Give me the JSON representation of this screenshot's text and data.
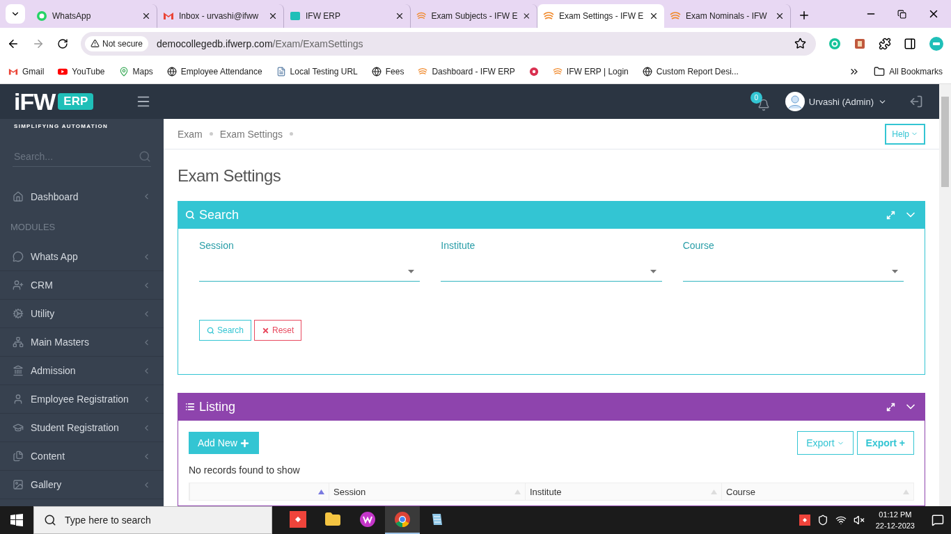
{
  "browser": {
    "tabs": [
      {
        "title": "WhatsApp",
        "kind": "whatsapp",
        "selected": false
      },
      {
        "title": "Inbox - urvashi@ifww",
        "kind": "gmail",
        "selected": false
      },
      {
        "title": "IFW ERP",
        "kind": "ifw",
        "selected": false
      },
      {
        "title": "Exam Subjects - IFW E",
        "kind": "swirl",
        "selected": false
      },
      {
        "title": "Exam Settings - IFW E",
        "kind": "swirl",
        "selected": true
      },
      {
        "title": "Exam Nominals - IFW",
        "kind": "swirl",
        "selected": false
      }
    ],
    "security": "Not secure",
    "url_host": "democollegedb.ifwerp.com",
    "url_path": "/Exam/ExamSettings",
    "bookmarks": [
      {
        "label": "Gmail",
        "kind": "gmail"
      },
      {
        "label": "YouTube",
        "kind": "youtube"
      },
      {
        "label": "Maps",
        "kind": "pin"
      },
      {
        "label": "Employee Attendance",
        "kind": "globe"
      },
      {
        "label": "Local Testing URL",
        "kind": "doc"
      },
      {
        "label": "Fees",
        "kind": "globe"
      },
      {
        "label": "Dashboard - IFW ERP",
        "kind": "swirl"
      },
      {
        "kind": "dot"
      },
      {
        "label": "IFW ERP | Login",
        "kind": "swirl"
      },
      {
        "label": "Custom Report Desi...",
        "kind": "globe"
      }
    ],
    "all_bookmarks": "All Bookmarks"
  },
  "brand": {
    "name": "iFW",
    "badge": "ERP",
    "tagline": "SIMPLIFYING AUTOMATION"
  },
  "sidebar": {
    "search_placeholder": "Search...",
    "items": [
      {
        "kind": "item",
        "label": "Dashboard"
      },
      {
        "kind": "heading",
        "label": "MODULES"
      },
      {
        "kind": "item",
        "label": "Whats App"
      },
      {
        "kind": "item",
        "label": "CRM"
      },
      {
        "kind": "item",
        "label": "Utility"
      },
      {
        "kind": "item",
        "label": "Main Masters"
      },
      {
        "kind": "item",
        "label": "Admission"
      },
      {
        "kind": "item",
        "label": "Employee Registration"
      },
      {
        "kind": "item",
        "label": "Student Registration"
      },
      {
        "kind": "item",
        "label": "Content"
      },
      {
        "kind": "item",
        "label": "Gallery"
      }
    ]
  },
  "topbar": {
    "notifications": "0",
    "user": "Urvashi (Admin)"
  },
  "breadcrumb": [
    "Exam",
    "Exam Settings"
  ],
  "help": "Help",
  "page_title": "Exam Settings",
  "search_panel": {
    "title": "Search",
    "fields": [
      {
        "label": "Session"
      },
      {
        "label": "Institute"
      },
      {
        "label": "Course"
      }
    ],
    "buttons": [
      {
        "label": "Search",
        "kind": "search"
      },
      {
        "label": "Reset",
        "kind": "reset"
      }
    ]
  },
  "listing_panel": {
    "title": "Listing",
    "add_button": "Add New",
    "export_buttons": [
      {
        "label": "Export",
        "kind": "dropdown"
      },
      {
        "label": "Export +",
        "kind": "plain"
      }
    ],
    "empty_message": "No records found to show",
    "columns": [
      {
        "sorted": true
      },
      {
        "label": "Session",
        "sorted": false
      },
      {
        "label": "Institute",
        "sorted": false
      },
      {
        "label": "Course",
        "sorted": false
      }
    ]
  },
  "taskbar": {
    "search_placeholder": "Type here to search",
    "apps": [
      {
        "kind": "anydesk",
        "selected": false
      },
      {
        "kind": "folder",
        "selected": false
      },
      {
        "kind": "wps",
        "selected": false
      },
      {
        "kind": "chrome",
        "selected": true
      },
      {
        "kind": "notepad",
        "selected": false
      }
    ],
    "time": "01:12 PM",
    "date": "22-12-2023"
  }
}
